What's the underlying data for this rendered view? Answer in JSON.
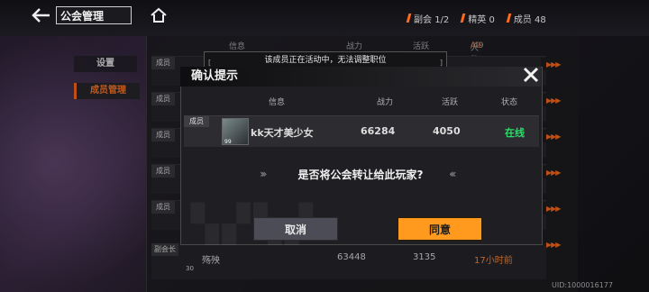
{
  "header": {
    "title": "公会管理",
    "stats": [
      {
        "label": "副会",
        "value": "1/2"
      },
      {
        "label": "精英",
        "value": "0"
      },
      {
        "label": "成员",
        "value": "48"
      }
    ]
  },
  "nav": {
    "settings": "设置",
    "members": "成员管理"
  },
  "table": {
    "columns": [
      "信息",
      "战力",
      "活跃",
      "人数"
    ],
    "count_current": "49",
    "count_total": "/49",
    "role_member": "成员",
    "role_leader": "副会长",
    "visible_status": "在线",
    "bottom_row": {
      "name": "殇殃",
      "level": "30",
      "power": "63448",
      "activity": "3135",
      "status": "17小时前"
    }
  },
  "toast": "该成员正在活动中，无法调整职位",
  "dialog": {
    "title": "确认提示",
    "columns": [
      "信息",
      "战力",
      "活跃",
      "状态"
    ],
    "member": {
      "role": "成员",
      "name": "kk天才美少女",
      "level": "99",
      "power": "66284",
      "activity": "4050",
      "status": "在线"
    },
    "question": "是否将公会转让给此玩家?",
    "cancel": "取消",
    "confirm": "同意"
  },
  "uid": "UID:1000016177",
  "colors": {
    "accent": "#ff6a1a",
    "online": "#2ddc6a",
    "confirm": "#ff9a1f"
  }
}
